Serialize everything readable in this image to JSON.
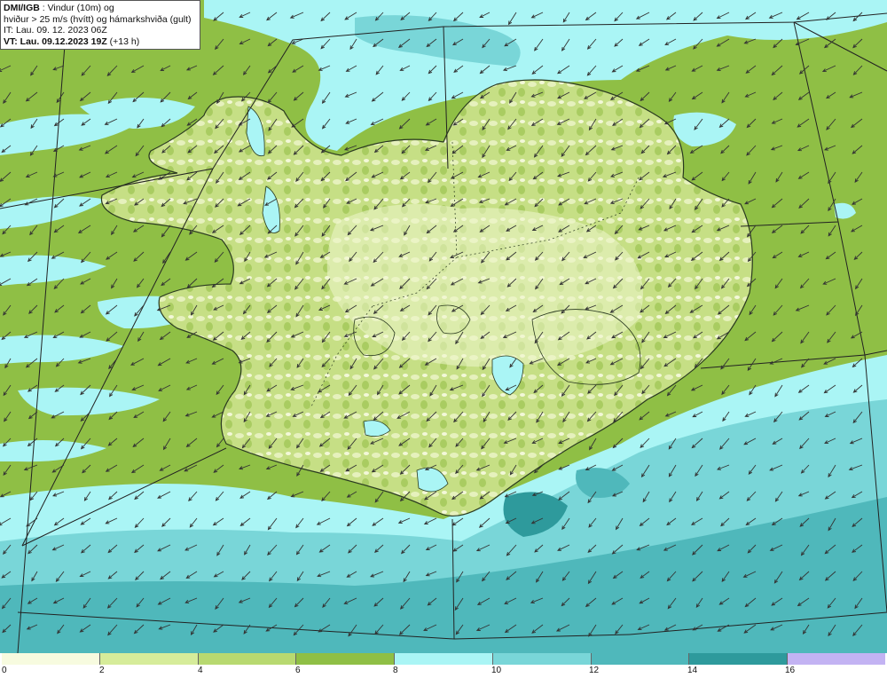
{
  "header": {
    "source_label": "DMI/IGB",
    "line1_rest": " : Vindur (10m) og",
    "line2": "hviður > 25 m/s (hvítt) og hámarkshviða (gult)",
    "line3": "IT: Lau. 09. 12. 2023 06Z",
    "line4_bold": "VT: Lau. 09.12.2023 19Z",
    "line4_rest": " (+13 h)"
  },
  "colorbar": {
    "labels": [
      "0",
      "2",
      "4",
      "6",
      "8",
      "10",
      "12",
      "14",
      "16"
    ],
    "colors": [
      "#f7fbdf",
      "#d6ec9a",
      "#b8d970",
      "#8fbf45",
      "#aaf5f5",
      "#79d6d8",
      "#4fb8bb",
      "#2e9a9c",
      "#c3b3f3"
    ]
  },
  "map": {
    "ocean_color": "#8fbf45",
    "land_color": "#c3dd82",
    "arrow_direction": "from-north-east"
  }
}
